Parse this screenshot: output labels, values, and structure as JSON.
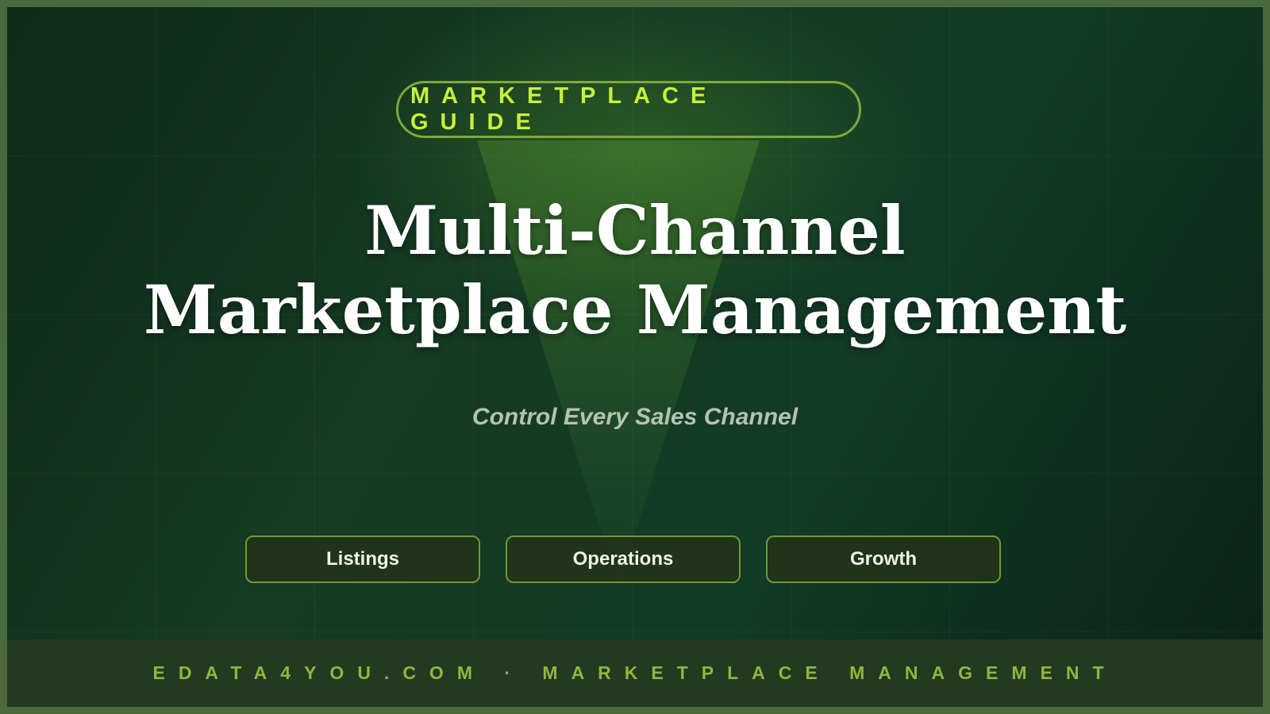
{
  "badge": {
    "label": "MARKETPLACE GUIDE"
  },
  "title": {
    "line1": "Multi-Channel",
    "line2": "Marketplace Management"
  },
  "subtitle": "Control Every Sales Channel",
  "tags": [
    {
      "label": "Listings"
    },
    {
      "label": "Operations"
    },
    {
      "label": "Growth"
    }
  ],
  "footer": {
    "text": "EDATA4YOU.COM · MARKETPLACE MANAGEMENT"
  },
  "colors": {
    "accent": "#c6f03c",
    "border_green": "#7fa83a",
    "footer_text": "#8db83e",
    "background_dark": "#0d2a1b"
  }
}
